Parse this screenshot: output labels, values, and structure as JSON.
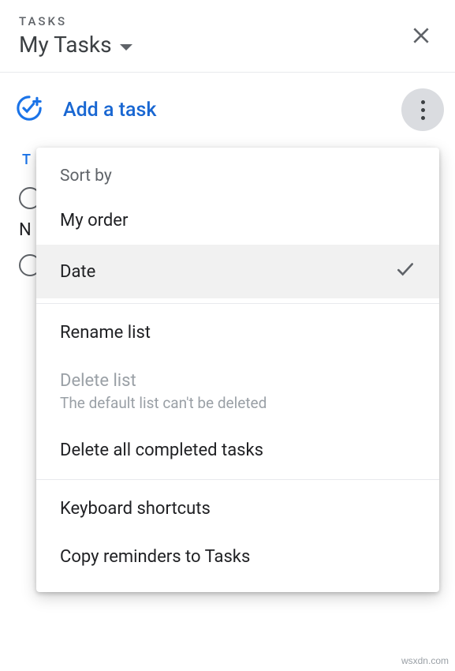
{
  "header": {
    "label": "TASKS",
    "listName": "My Tasks"
  },
  "toolbar": {
    "addTask": "Add a task"
  },
  "tasks": {
    "timeHint": "T",
    "nHint": "N"
  },
  "menu": {
    "sortBy": "Sort by",
    "myOrder": "My order",
    "date": "Date",
    "renameList": "Rename list",
    "deleteList": "Delete list",
    "deleteListSub": "The default list can't be deleted",
    "deleteCompleted": "Delete all completed tasks",
    "keyboardShortcuts": "Keyboard shortcuts",
    "copyReminders": "Copy reminders to Tasks"
  },
  "watermark": "wsxdn.com"
}
